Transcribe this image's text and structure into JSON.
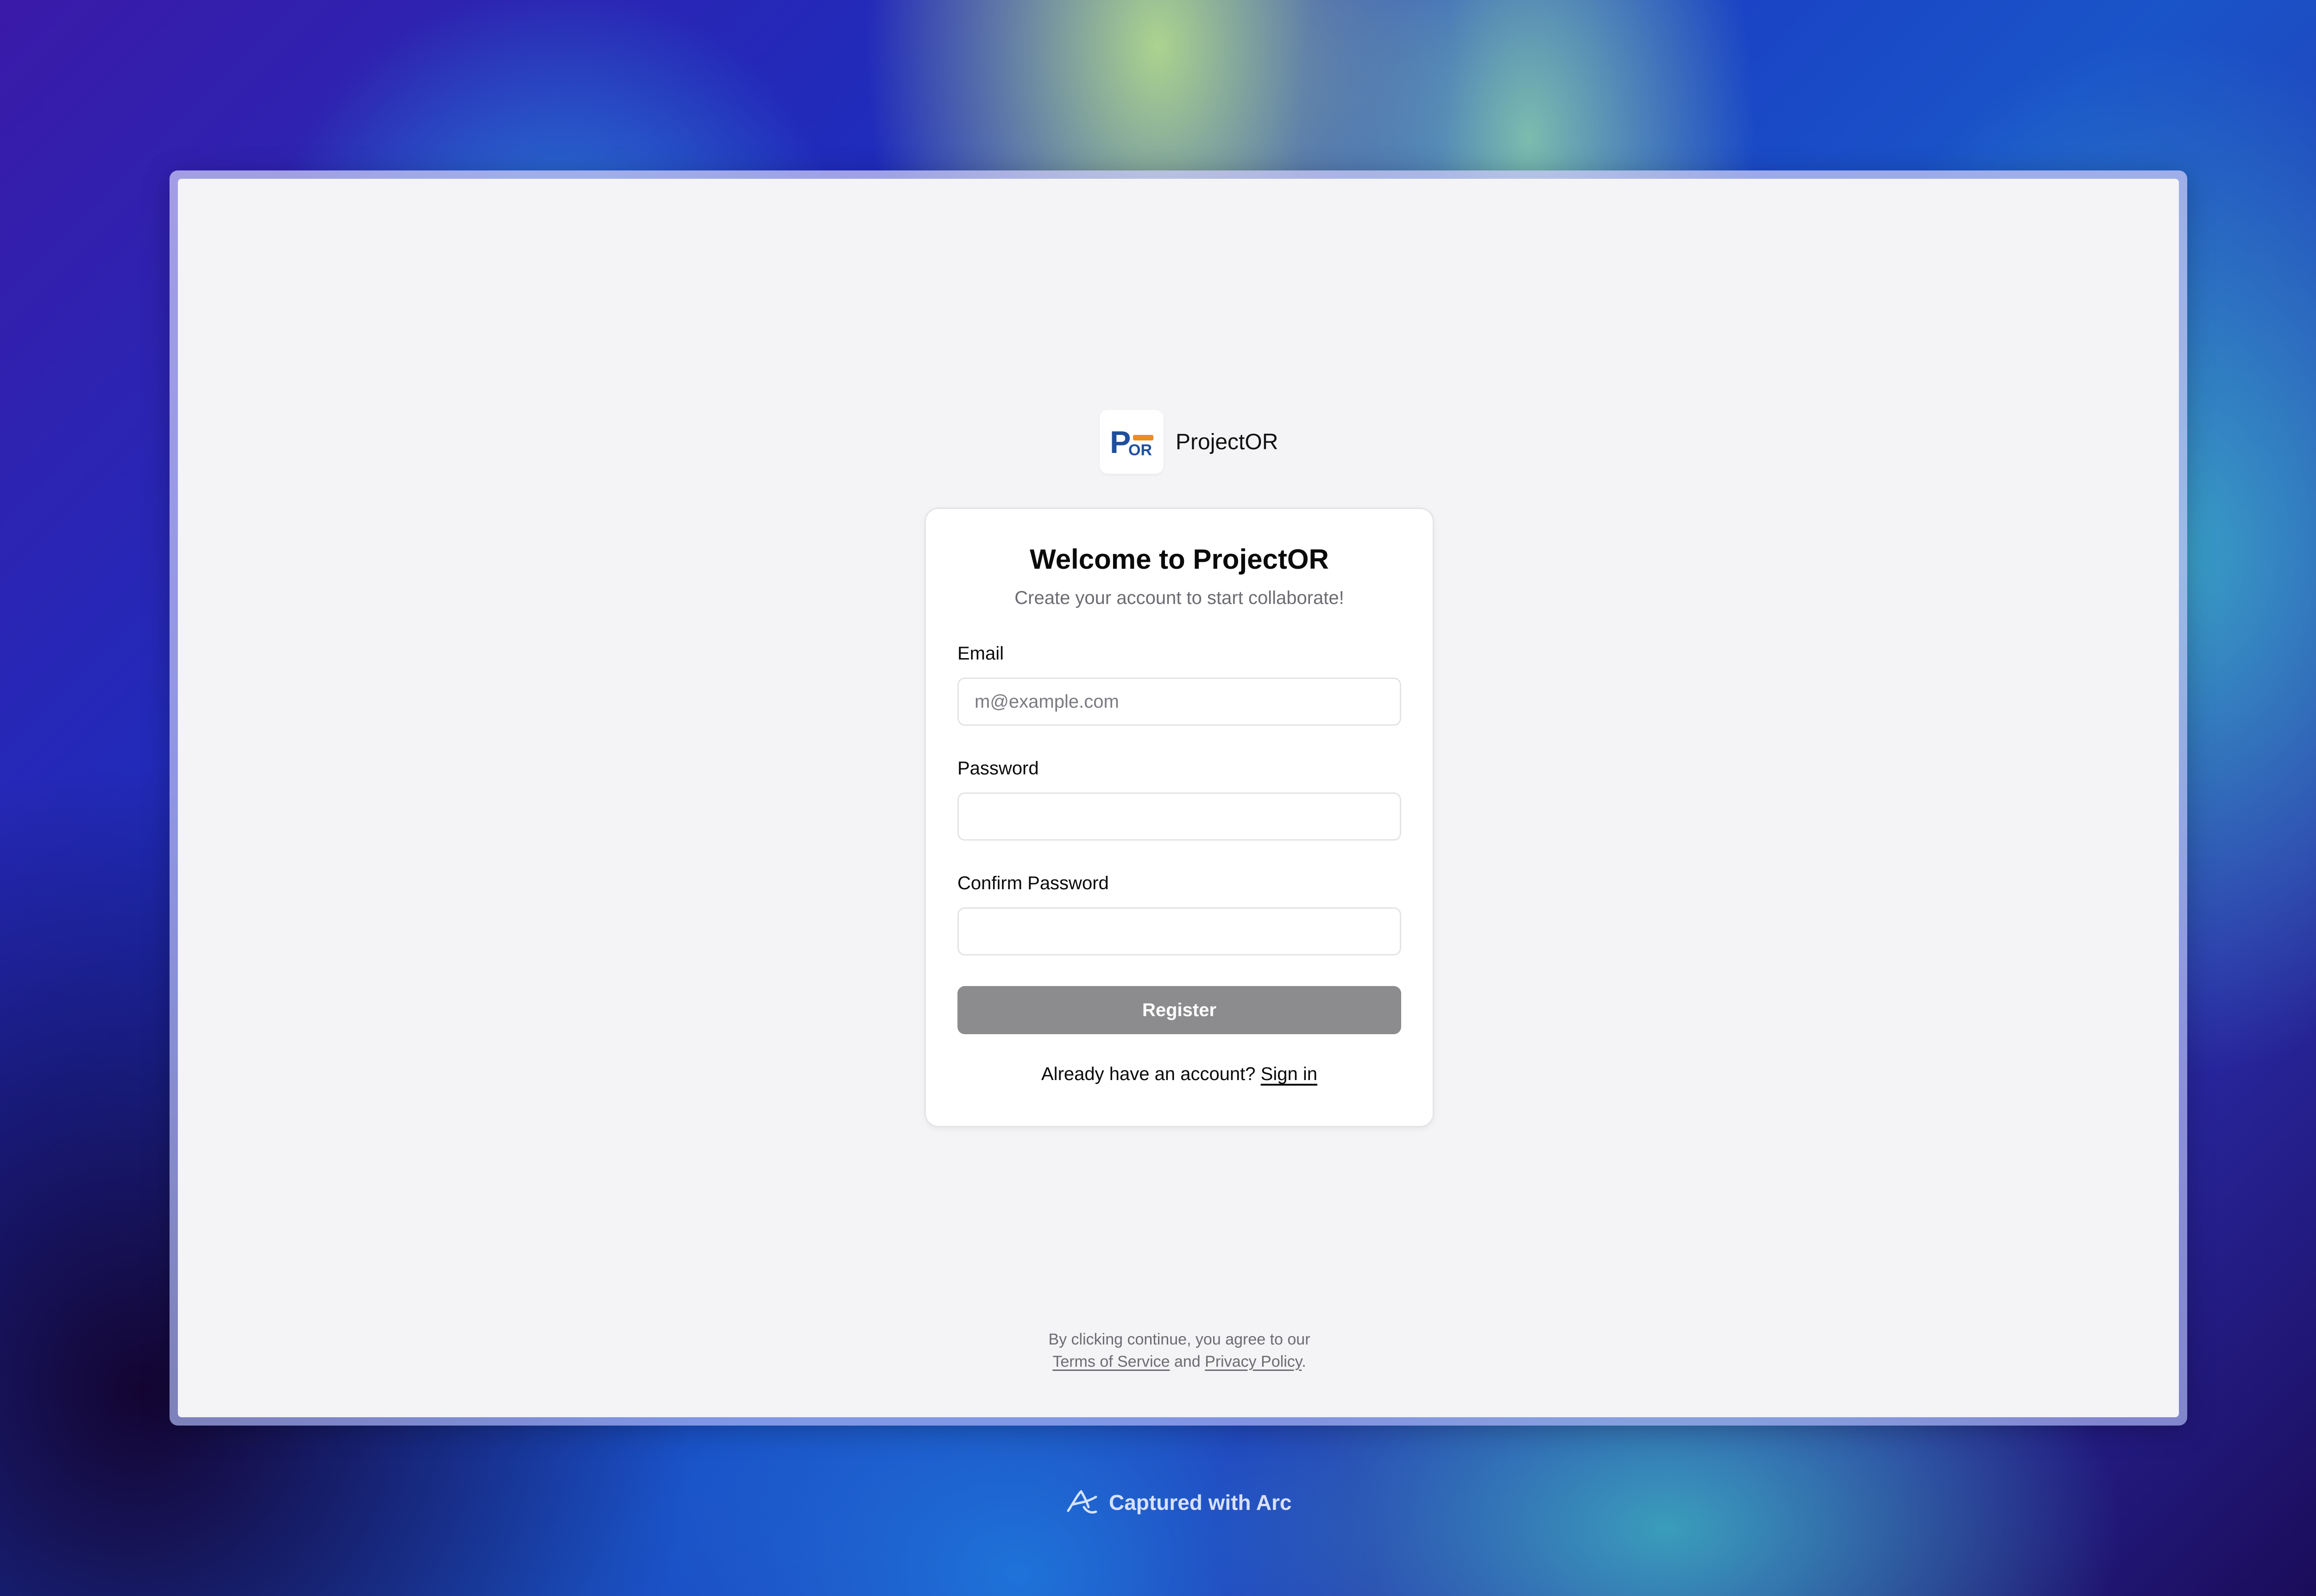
{
  "brand": {
    "logo_text_p": "P",
    "logo_text_or": "OR",
    "name": "ProjectOR"
  },
  "card": {
    "title": "Welcome to ProjectOR",
    "subtitle": "Create your account to start collaborate!",
    "email": {
      "label": "Email",
      "placeholder": "m@example.com",
      "value": ""
    },
    "password": {
      "label": "Password",
      "value": ""
    },
    "confirm_password": {
      "label": "Confirm Password",
      "value": ""
    },
    "register_label": "Register",
    "signin_prompt": "Already have an account?",
    "signin_link": "Sign in"
  },
  "legal": {
    "prefix": "By clicking continue, you agree to our",
    "terms": "Terms of Service",
    "and": "and",
    "privacy": "Privacy Policy",
    "suffix": "."
  },
  "caption": {
    "text": "Captured with Arc",
    "icon": "arc-icon"
  },
  "colors": {
    "register_bg": "#8c8c8f",
    "logo_blue": "#1f4f9c",
    "logo_orange": "#f08a24",
    "window_bg": "#f4f4f6"
  }
}
